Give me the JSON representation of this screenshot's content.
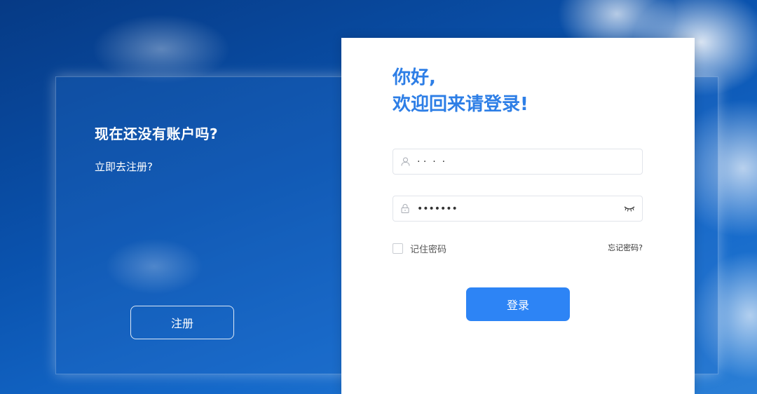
{
  "left": {
    "title": "现在还没有账户吗?",
    "subtitle": "立即去注册?",
    "register_label": "注册"
  },
  "card": {
    "greeting_line1": "你好,",
    "greeting_line2": "欢迎回来请登录!",
    "username_value": "· ·  ·  ·",
    "password_value": "•••••••",
    "remember_label": "记住密码",
    "forgot_label": "忘记密码?",
    "login_label": "登录"
  },
  "icons": {
    "user": "user-icon",
    "lock": "lock-icon",
    "eye": "eye-closed-icon"
  },
  "colors": {
    "accent": "#2d84f5",
    "title": "#2d7ee6"
  }
}
